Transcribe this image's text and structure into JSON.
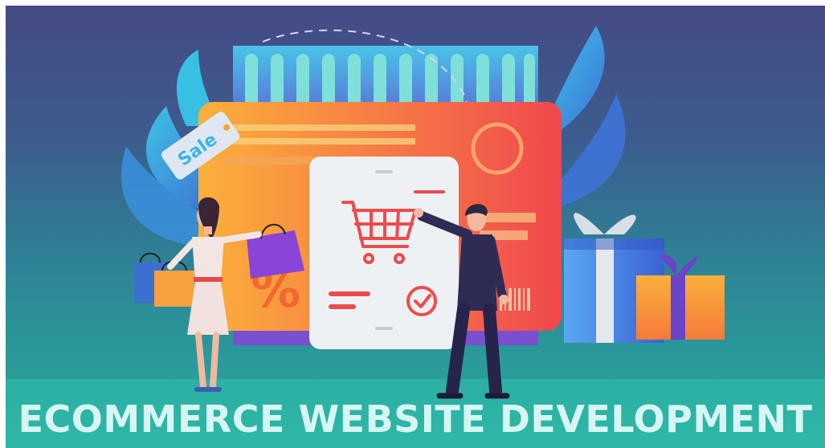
{
  "banner": {
    "title": "ECOMMERCE WEBSITE DEVELOPMENT",
    "sale_tag": "Sale",
    "percent_sign": "%"
  },
  "icons": [
    "cart-icon",
    "check-icon",
    "percent-icon",
    "sale-tag-icon",
    "gift-box-icon",
    "shopping-bag-icon"
  ],
  "colors": {
    "background_top": "#444a85",
    "background_bottom": "#27a69c",
    "card_gradient_start": "#fbb03b",
    "card_gradient_end": "#f0484e",
    "title_color": "#d7f6f3",
    "accent_red": "#ef4b4b"
  }
}
